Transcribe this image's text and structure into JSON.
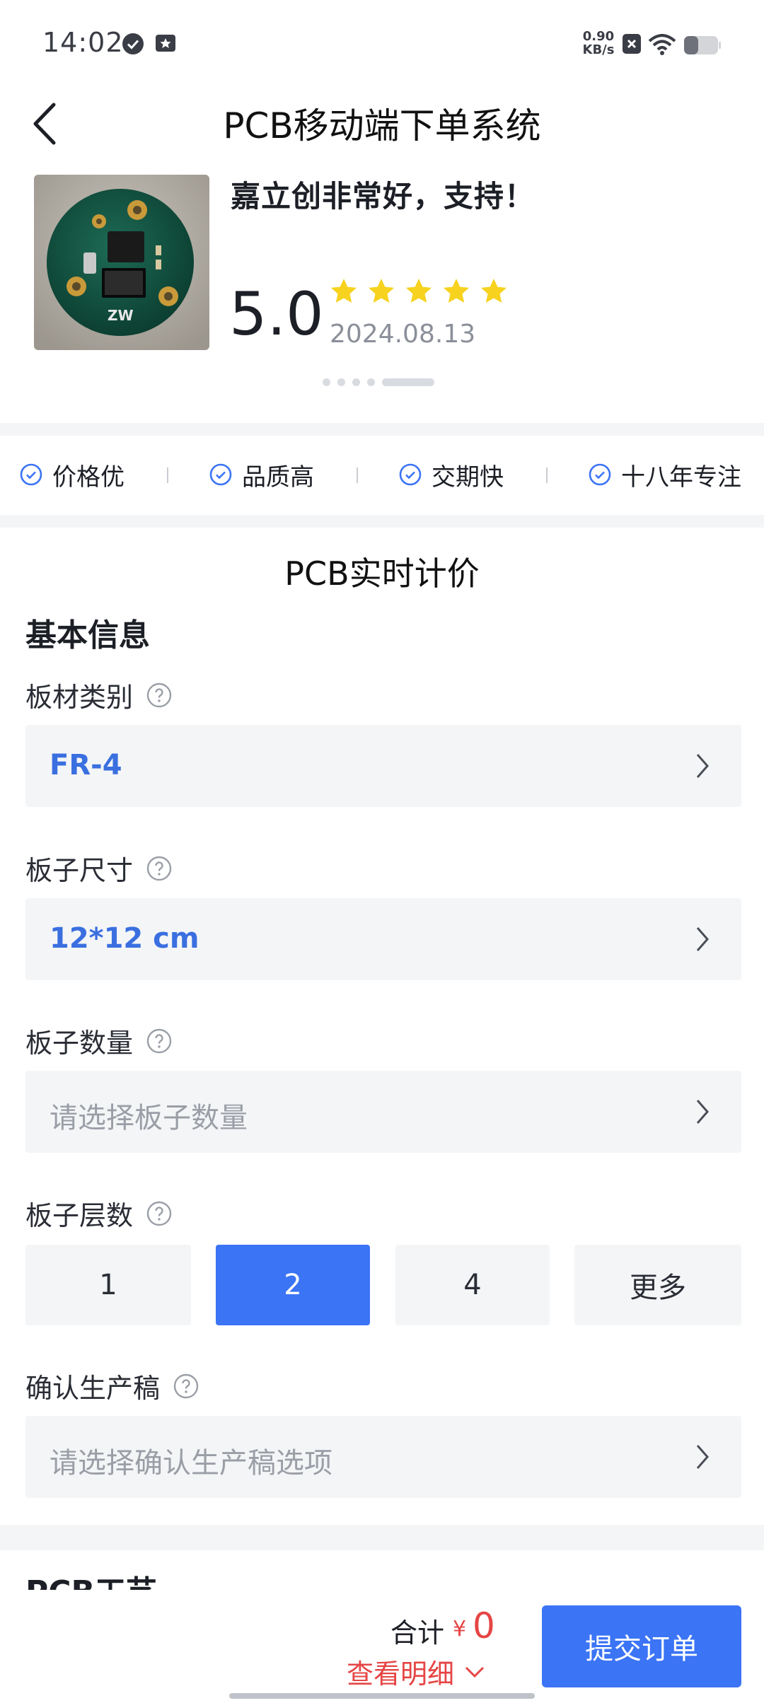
{
  "status_bar": {
    "time": "14:02",
    "net_speed_value": "0.90",
    "net_speed_unit": "KB/s",
    "icons": [
      "check-badge-icon",
      "notification-icon",
      "close-box-icon",
      "wifi-icon",
      "battery-icon"
    ]
  },
  "header": {
    "title": "PCB移动端下单系统"
  },
  "review": {
    "text": "嘉立创非常好，支持！",
    "score": "5.0",
    "stars": 5,
    "date": "2024.08.13",
    "carousel_pages": 5,
    "carousel_active_index": 4,
    "photo_label": "ZW"
  },
  "features": [
    {
      "label": "价格优"
    },
    {
      "label": "品质高"
    },
    {
      "label": "交期快"
    },
    {
      "label": "十八年专注"
    }
  ],
  "pricing": {
    "section_title": "PCB实时计价",
    "group_title": "基本信息",
    "material": {
      "label": "板材类别",
      "value": "FR-4"
    },
    "size": {
      "label": "板子尺寸",
      "value": "12*12 cm"
    },
    "quantity": {
      "label": "板子数量",
      "placeholder": "请选择板子数量"
    },
    "layers": {
      "label": "板子层数",
      "options": [
        "1",
        "2",
        "4",
        "更多"
      ],
      "selected": "2"
    },
    "confirm": {
      "label": "确认生产稿",
      "placeholder": "请选择确认生产稿选项"
    },
    "next_group_title": "PCB工艺"
  },
  "bottom_bar": {
    "total_label": "合计",
    "currency": "¥",
    "total_value": "0",
    "detail_link": "查看明细",
    "submit_label": "提交订单"
  },
  "colors": {
    "accent": "#3b74f5",
    "link_blue": "#3a6fe0",
    "price_red": "#e64545",
    "star_yellow": "#f7d21e",
    "field_bg": "#f4f5f7"
  }
}
